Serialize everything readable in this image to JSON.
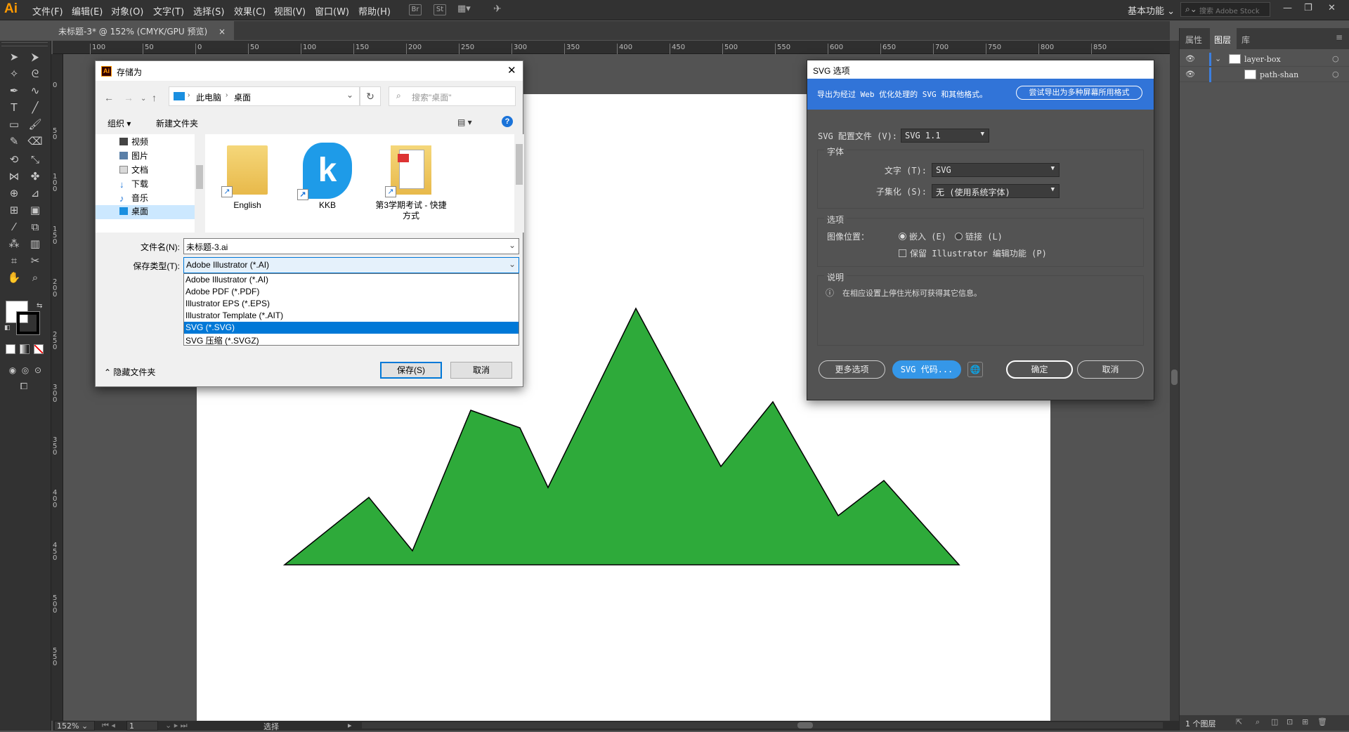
{
  "app": {
    "logo": "Ai",
    "workspace": "基本功能",
    "stock_search_placeholder": "搜索 Adobe Stock"
  },
  "menu": [
    "文件(F)",
    "编辑(E)",
    "对象(O)",
    "文字(T)",
    "选择(S)",
    "效果(C)",
    "视图(V)",
    "窗口(W)",
    "帮助(H)"
  ],
  "toolbar_icons": {
    "bridge": "Br",
    "stock": "St"
  },
  "document_tab": {
    "title": "未标题-3* @ 152% (CMYK/GPU 预览)",
    "close": "×"
  },
  "ruler_top": [
    "100",
    "50",
    "0",
    "50",
    "100",
    "150",
    "200",
    "250",
    "300",
    "350",
    "400",
    "450",
    "500",
    "550",
    "600",
    "650",
    "700",
    "750",
    "800",
    "850"
  ],
  "ruler_left": [
    "0",
    "50",
    "100",
    "150",
    "200",
    "250",
    "300",
    "350",
    "400",
    "450",
    "500",
    "550"
  ],
  "artwork": {
    "fill": "#2eaa3a",
    "stroke": "#000000"
  },
  "status": {
    "zoom": "152%",
    "artboard": "1",
    "mode": "选择"
  },
  "right_panel": {
    "tabs": [
      "属性",
      "图层",
      "库"
    ],
    "layers": [
      {
        "name": "layer-box"
      },
      {
        "name": "path-shan"
      }
    ],
    "status": "1 个图层"
  },
  "save_dialog": {
    "title": "存储为",
    "breadcrumb": [
      "此电脑",
      "桌面"
    ],
    "search_placeholder": "搜索\"桌面\"",
    "organize": "组织 ▾",
    "new_folder": "新建文件夹",
    "tree": [
      "视频",
      "图片",
      "文档",
      "下载",
      "音乐",
      "桌面"
    ],
    "files": [
      {
        "name": "English"
      },
      {
        "name": "KKB"
      },
      {
        "name": "第3学期考试 - 快捷方式"
      }
    ],
    "filename_label": "文件名(N):",
    "filename": "未标题-3.ai",
    "filetype_label": "保存类型(T):",
    "filetype": "Adobe Illustrator (*.AI)",
    "types": [
      "Adobe Illustrator (*.AI)",
      "Adobe PDF (*.PDF)",
      "Illustrator EPS (*.EPS)",
      "Illustrator Template (*.AIT)",
      "SVG (*.SVG)",
      "SVG 压缩 (*.SVGZ)"
    ],
    "selected_type_index": 4,
    "hide_folders": "隐藏文件夹",
    "save": "保存(S)",
    "cancel": "取消"
  },
  "svg_dialog": {
    "title": "SVG 选项",
    "banner_text": "导出为经过 Web 优化处理的 SVG 和其他格式。",
    "banner_button": "尝试导出为多种屏幕所用格式",
    "profile_label": "SVG 配置文件 (V):",
    "profile_value": "SVG 1.1",
    "font_group": "字体",
    "type_label": "文字 (T):",
    "type_value": "SVG",
    "subset_label": "子集化 (S):",
    "subset_value": "无 (使用系统字体)",
    "options_group": "选项",
    "image_location_label": "图像位置：",
    "embed": "嵌入 (E)",
    "link": "链接 (L)",
    "preserve": "保留 Illustrator 编辑功能 (P)",
    "desc_group": "说明",
    "desc_text": "在相应设置上停住光标可获得其它信息。",
    "more_options": "更多选项",
    "svg_code": "SVG 代码...",
    "ok": "确定",
    "cancel": "取消"
  }
}
